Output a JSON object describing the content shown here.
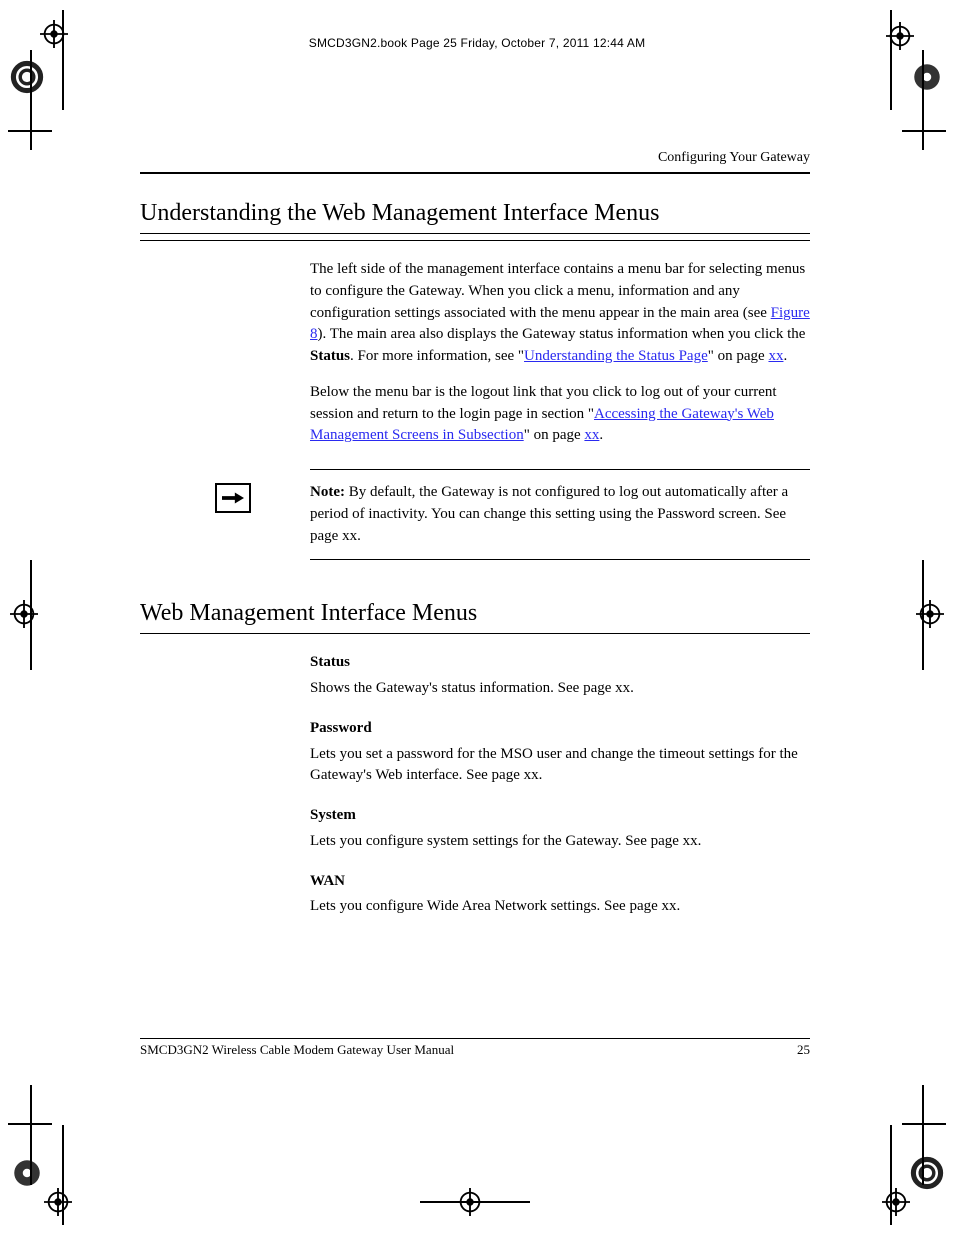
{
  "stamp": "SMCD3GN2.book  Page 25  Friday, October 7, 2011  12:44 AM",
  "header": {
    "chapter": "Configuring Your Gateway"
  },
  "section1": {
    "title": "Understanding the Web Management Interface Menus",
    "para1_a": "The left side of the management interface contains a menu bar for selecting menus to configure the Gateway. When you click a menu, information and any configuration settings associated with the menu appear in the main area (see ",
    "link1": "Figure 8",
    "para1_b": "). The main area also displays the Gateway status information when you click the ",
    "bold1": "Status",
    "para1_c": ". For more information, see \"",
    "link2": "Understanding the Status Page",
    "para1_d": "\" on page ",
    "link3": "xx",
    "para1_e": ".",
    "para2_a": "Below the menu bar is the logout link that you click to log out of your current session and return to the login page in section \"",
    "link4": "Accessing the Gateway's Web Management Screens in Subsection",
    "para2_b": "\" on page",
    "link5": "xx",
    "para2_c": ".",
    "note_label": "Note:",
    "note_text": " By default, the Gateway is not configured to log out automatically after a period of inactivity. You can change this setting using the Password screen. See page xx."
  },
  "section2": {
    "title": "Web Management Interface Menus",
    "items": [
      {
        "heading": "Status",
        "text": "Shows the Gateway's status information. See page xx."
      },
      {
        "heading": "Password",
        "text": "Lets you set a password for the MSO user and change the timeout settings for the Gateway's Web interface. See page xx."
      },
      {
        "heading": "System",
        "text": "Lets you configure system settings for the Gateway. See page xx."
      },
      {
        "heading": "WAN",
        "text": "Lets you configure Wide Area Network settings. See page xx."
      }
    ]
  },
  "footer": {
    "left": "SMCD3GN2 Wireless Cable Modem Gateway User Manual",
    "right": "25"
  }
}
